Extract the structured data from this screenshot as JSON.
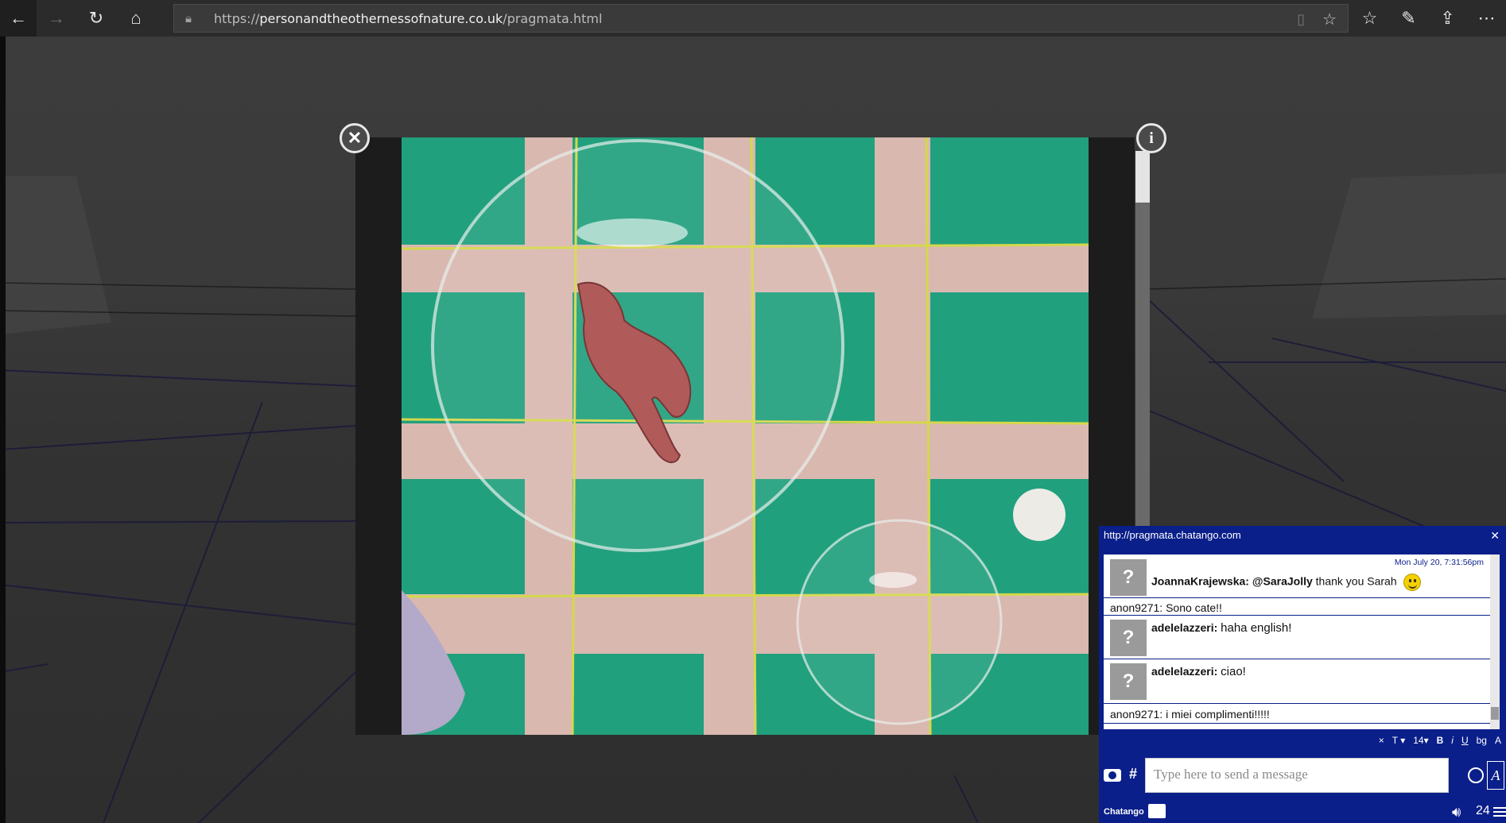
{
  "browser": {
    "url_scheme": "https://",
    "url_host": "personandtheothernessofnature.co.uk",
    "url_path": "/pragmata.html"
  },
  "chat": {
    "header_url": "http://pragmata.chatango.com",
    "messages": [
      {
        "time": "Mon July 20, 7:31:56pm",
        "user": "JoannaKrajewska:",
        "mention": "@SaraJolly",
        "text": "thank you Sarah"
      },
      {
        "user": "anon9271:",
        "text": "Sono cate!!"
      },
      {
        "user": "adelelazzeri:",
        "text": "haha english!"
      },
      {
        "user": "adelelazzeri:",
        "text": "ciao!"
      },
      {
        "user": "anon9271:",
        "text": "i miei complimenti!!!!!"
      }
    ],
    "format_bar": {
      "clear": "×",
      "font": "T",
      "size": "14",
      "bold": "B",
      "italic": "i",
      "underline": "U",
      "bg": "bg",
      "a": "A"
    },
    "input_placeholder": "Type here to send a message",
    "hash": "#",
    "style_label": "A",
    "brand": "Chatango",
    "user_count": "24"
  }
}
